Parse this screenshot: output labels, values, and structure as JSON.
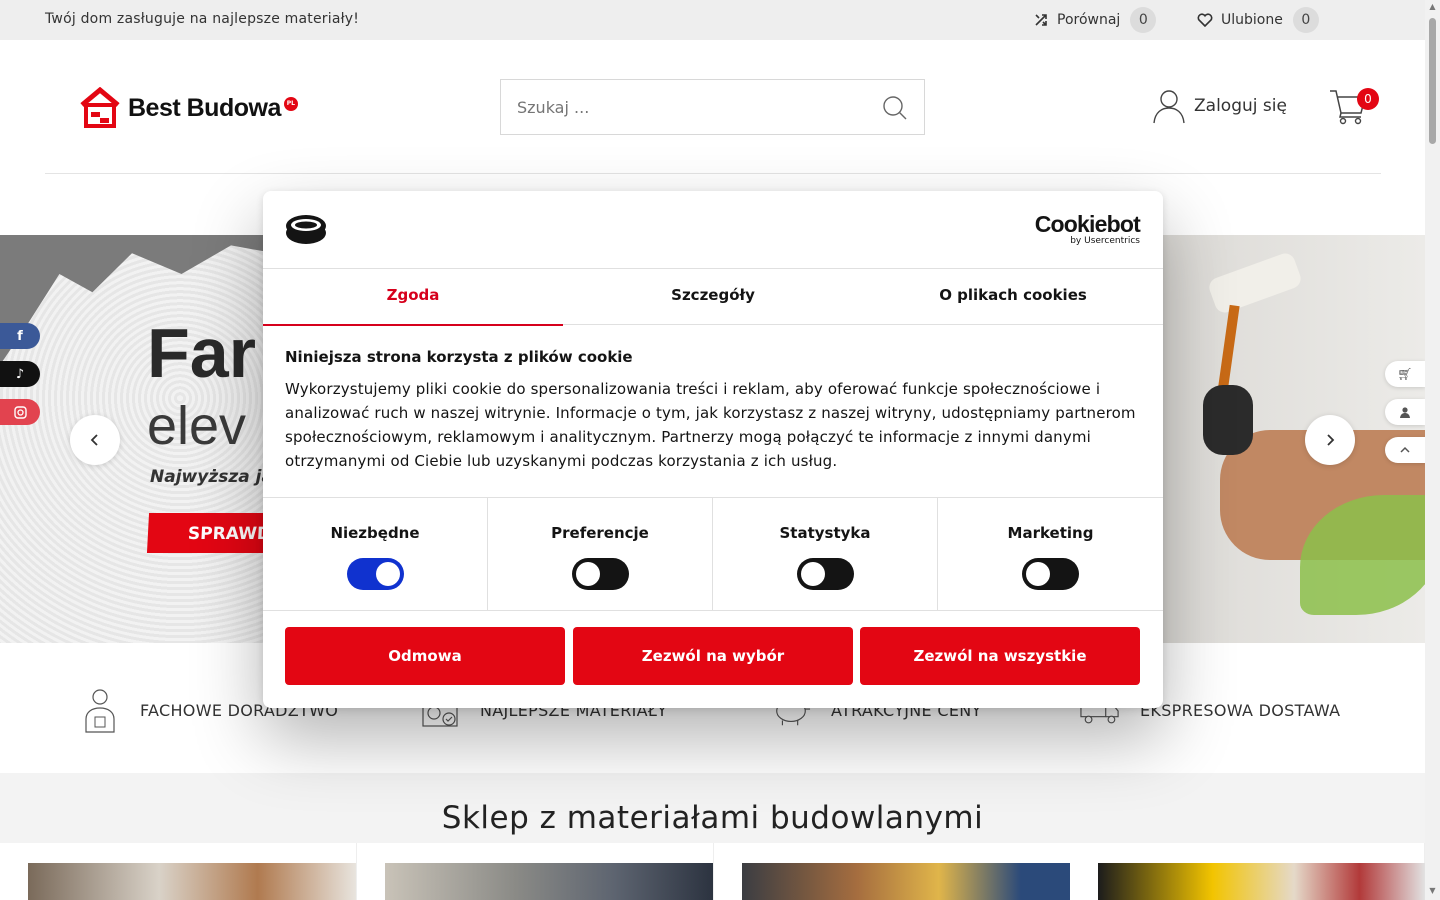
{
  "topbar": {
    "promo": "Twój dom zasługuje na najlepsze materiały!",
    "compare_label": "Porównaj",
    "compare_count": "0",
    "favorites_label": "Ulubione",
    "favorites_count": "0"
  },
  "header": {
    "logo_text": "Best Budowa",
    "logo_badge": "PL",
    "search_placeholder": "Szukaj ...",
    "login_label": "Zaloguj się",
    "cart_count": "0"
  },
  "hero": {
    "title_partial": "Far",
    "subtitle_partial": "elev",
    "tagline_partial": "Najwyższa ja",
    "button_partial": "SPRAWD"
  },
  "features": [
    {
      "label": "FACHOWE DORADZTWO",
      "icon": "advisor-icon"
    },
    {
      "label": "NAJLEPSZE MATERIAŁY",
      "icon": "materials-icon"
    },
    {
      "label": "ATRAKCYJNE CENY",
      "icon": "piggy-bank-icon"
    },
    {
      "label": "EKSPRESOWA DOSTAWA",
      "icon": "truck-icon"
    }
  ],
  "shop": {
    "title": "Sklep z materiałami budowlanymi"
  },
  "cookie": {
    "brand": "Cookiebot",
    "brand_sub": "by Usercentrics",
    "tabs": [
      "Zgoda",
      "Szczegóły",
      "O plikach cookies"
    ],
    "heading": "Niniejsza strona korzysta z plików cookie",
    "body": "Wykorzystujemy pliki cookie do spersonalizowania treści i reklam, aby oferować funkcje społecznościowe i analizować ruch w naszej witrynie. Informacje o tym, jak korzystasz z naszej witryny, udostępniamy partnerom społecznościowym, reklamowym i analitycznym. Partnerzy mogą połączyć te informacje z innymi danymi otrzymanymi od Ciebie lub uzyskanymi podczas korzystania z ich usług.",
    "categories": [
      {
        "label": "Niezbędne",
        "checked": true
      },
      {
        "label": "Preferencje",
        "checked": false
      },
      {
        "label": "Statystyka",
        "checked": false
      },
      {
        "label": "Marketing",
        "checked": false
      }
    ],
    "buttons": {
      "deny": "Odmowa",
      "allow_selection": "Zezwól na wybór",
      "allow_all": "Zezwól na wszystkie"
    }
  },
  "colors": {
    "brand_red": "#e30613",
    "toggle_on": "#1032cf",
    "tab_active": "#d6001c"
  }
}
